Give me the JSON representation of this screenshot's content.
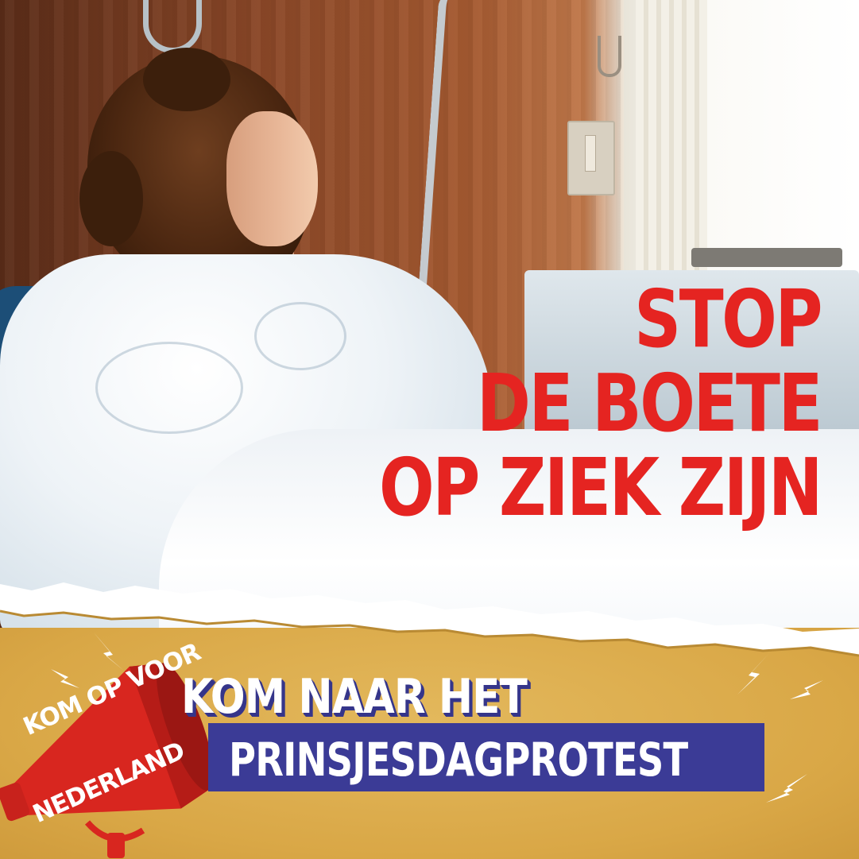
{
  "headline": {
    "line1": "STOP",
    "line2": "DE BOETE",
    "line3": "OP ZIEK ZIJN",
    "color": "#e52421"
  },
  "banner": {
    "call_line1": "KOM NAAR HET",
    "call_line2": "PRINSJESDAGPROTEST",
    "background_color": "#dcae4f",
    "box_color": "#3b3b96"
  },
  "logo": {
    "line1": "KOM OP VOOR",
    "line2": "NEDERLAND",
    "icon": "megaphone-icon",
    "color": "#d8261f"
  },
  "decorations": {
    "bolt_icon": "lightning-bolt-icon",
    "photo_subject": "hospital-patient-photo"
  }
}
